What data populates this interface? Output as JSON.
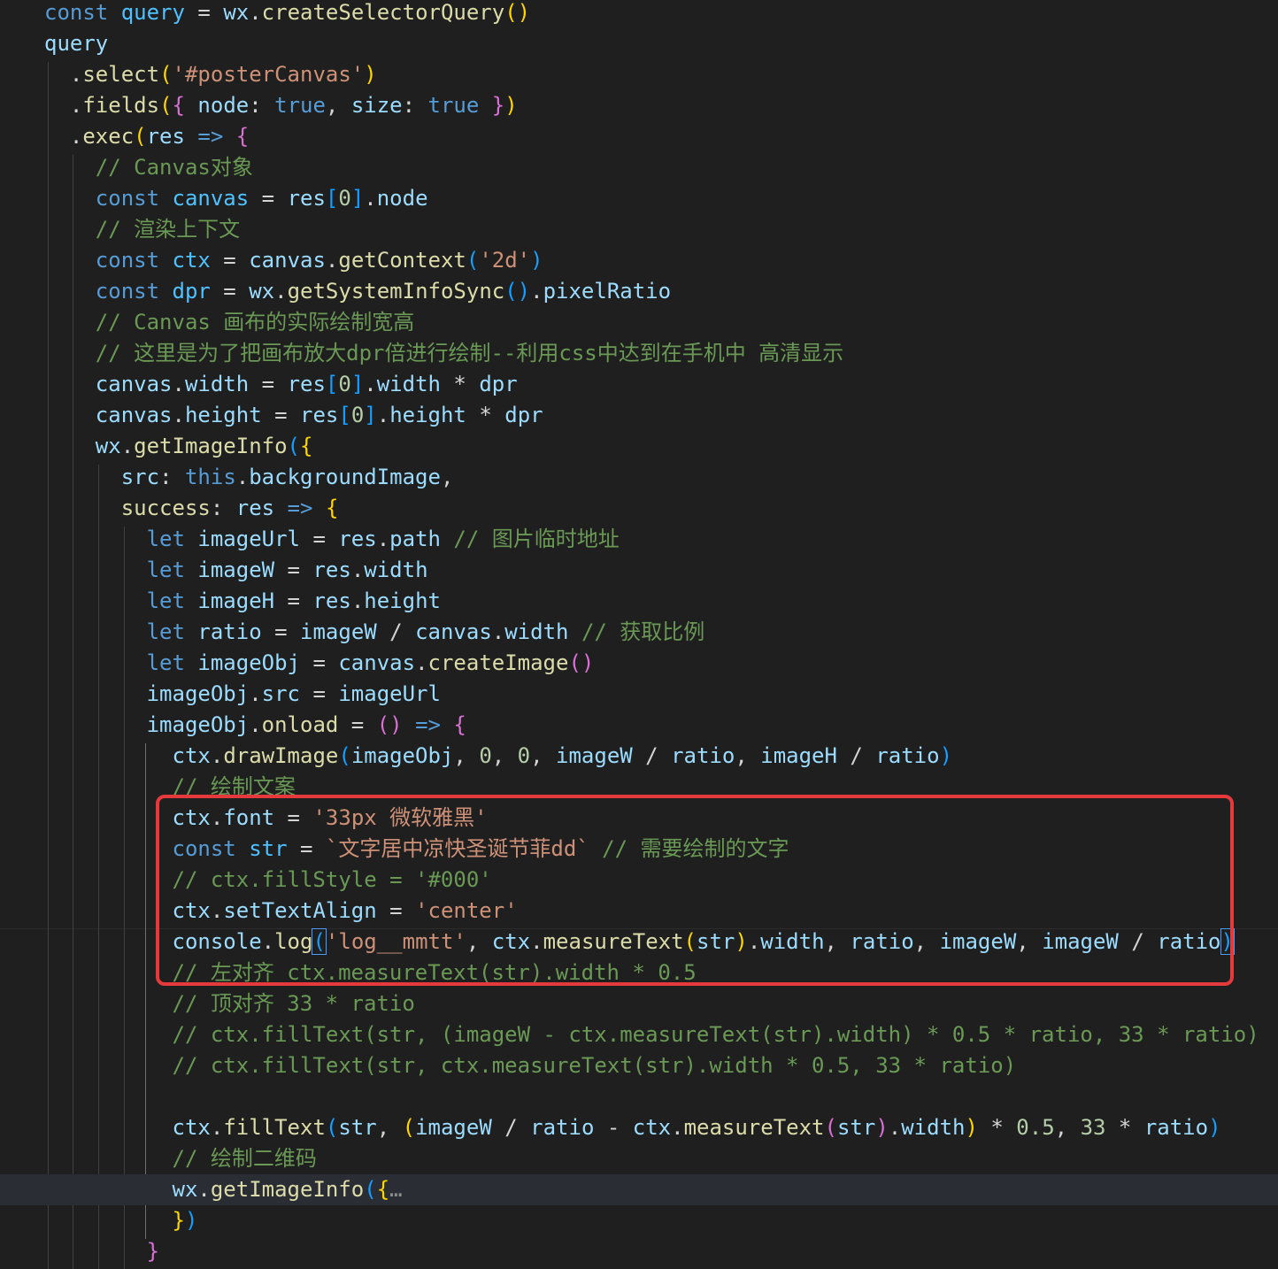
{
  "editor": {
    "lines": [
      [
        [
          "kw",
          "const"
        ],
        [
          "op",
          " "
        ],
        [
          "cst",
          "query"
        ],
        [
          "op",
          " = "
        ],
        [
          "v",
          "wx"
        ],
        [
          "op",
          "."
        ],
        [
          "fn",
          "createSelectorQuery"
        ],
        [
          "b1",
          "()"
        ]
      ],
      [
        [
          "v",
          "query"
        ]
      ],
      [
        [
          "op",
          "  ."
        ],
        [
          "fn",
          "select"
        ],
        [
          "b1",
          "("
        ],
        [
          "s",
          "'#posterCanvas'"
        ],
        [
          "b1",
          ")"
        ]
      ],
      [
        [
          "op",
          "  ."
        ],
        [
          "fn",
          "fields"
        ],
        [
          "b1",
          "("
        ],
        [
          "b2",
          "{"
        ],
        [
          "op",
          " "
        ],
        [
          "v",
          "node"
        ],
        [
          "op",
          ": "
        ],
        [
          "kw",
          "true"
        ],
        [
          "op",
          ", "
        ],
        [
          "v",
          "size"
        ],
        [
          "op",
          ": "
        ],
        [
          "kw",
          "true"
        ],
        [
          "op",
          " "
        ],
        [
          "b2",
          "}"
        ],
        [
          "b1",
          ")"
        ]
      ],
      [
        [
          "op",
          "  ."
        ],
        [
          "fn",
          "exec"
        ],
        [
          "b1",
          "("
        ],
        [
          "v",
          "res"
        ],
        [
          "op",
          " "
        ],
        [
          "kw",
          "=>"
        ],
        [
          "op",
          " "
        ],
        [
          "b2",
          "{"
        ]
      ],
      [
        [
          "c",
          "    // Canvas对象"
        ]
      ],
      [
        [
          "op",
          "    "
        ],
        [
          "kw",
          "const"
        ],
        [
          "op",
          " "
        ],
        [
          "cst",
          "canvas"
        ],
        [
          "op",
          " = "
        ],
        [
          "v",
          "res"
        ],
        [
          "b3",
          "["
        ],
        [
          "n",
          "0"
        ],
        [
          "b3",
          "]"
        ],
        [
          "op",
          "."
        ],
        [
          "v",
          "node"
        ]
      ],
      [
        [
          "c",
          "    // 渲染上下文"
        ]
      ],
      [
        [
          "op",
          "    "
        ],
        [
          "kw",
          "const"
        ],
        [
          "op",
          " "
        ],
        [
          "cst",
          "ctx"
        ],
        [
          "op",
          " = "
        ],
        [
          "v",
          "canvas"
        ],
        [
          "op",
          "."
        ],
        [
          "fn",
          "getContext"
        ],
        [
          "b3",
          "("
        ],
        [
          "s",
          "'2d'"
        ],
        [
          "b3",
          ")"
        ]
      ],
      [
        [
          "op",
          "    "
        ],
        [
          "kw",
          "const"
        ],
        [
          "op",
          " "
        ],
        [
          "cst",
          "dpr"
        ],
        [
          "op",
          " = "
        ],
        [
          "v",
          "wx"
        ],
        [
          "op",
          "."
        ],
        [
          "fn",
          "getSystemInfoSync"
        ],
        [
          "b3",
          "()"
        ],
        [
          "op",
          "."
        ],
        [
          "v",
          "pixelRatio"
        ]
      ],
      [
        [
          "c",
          "    // Canvas 画布的实际绘制宽高"
        ]
      ],
      [
        [
          "c",
          "    // 这里是为了把画布放大dpr倍进行绘制--利用css中达到在手机中 高清显示"
        ]
      ],
      [
        [
          "op",
          "    "
        ],
        [
          "v",
          "canvas"
        ],
        [
          "op",
          "."
        ],
        [
          "v",
          "width"
        ],
        [
          "op",
          " = "
        ],
        [
          "v",
          "res"
        ],
        [
          "b3",
          "["
        ],
        [
          "n",
          "0"
        ],
        [
          "b3",
          "]"
        ],
        [
          "op",
          "."
        ],
        [
          "v",
          "width"
        ],
        [
          "op",
          " * "
        ],
        [
          "v",
          "dpr"
        ]
      ],
      [
        [
          "op",
          "    "
        ],
        [
          "v",
          "canvas"
        ],
        [
          "op",
          "."
        ],
        [
          "v",
          "height"
        ],
        [
          "op",
          " = "
        ],
        [
          "v",
          "res"
        ],
        [
          "b3",
          "["
        ],
        [
          "n",
          "0"
        ],
        [
          "b3",
          "]"
        ],
        [
          "op",
          "."
        ],
        [
          "v",
          "height"
        ],
        [
          "op",
          " * "
        ],
        [
          "v",
          "dpr"
        ]
      ],
      [
        [
          "op",
          "    "
        ],
        [
          "v",
          "wx"
        ],
        [
          "op",
          "."
        ],
        [
          "fn",
          "getImageInfo"
        ],
        [
          "b3",
          "("
        ],
        [
          "b1",
          "{"
        ]
      ],
      [
        [
          "op",
          "      "
        ],
        [
          "v",
          "src"
        ],
        [
          "op",
          ": "
        ],
        [
          "kw",
          "this"
        ],
        [
          "op",
          "."
        ],
        [
          "v",
          "backgroundImage"
        ],
        [
          "op",
          ","
        ]
      ],
      [
        [
          "op",
          "      "
        ],
        [
          "fn",
          "success"
        ],
        [
          "op",
          ": "
        ],
        [
          "v",
          "res"
        ],
        [
          "op",
          " "
        ],
        [
          "kw",
          "=>"
        ],
        [
          "op",
          " "
        ],
        [
          "b1",
          "{"
        ]
      ],
      [
        [
          "op",
          "        "
        ],
        [
          "kw",
          "let"
        ],
        [
          "op",
          " "
        ],
        [
          "v",
          "imageUrl"
        ],
        [
          "op",
          " = "
        ],
        [
          "v",
          "res"
        ],
        [
          "op",
          "."
        ],
        [
          "v",
          "path"
        ],
        [
          "op",
          " "
        ],
        [
          "c",
          "// 图片临时地址"
        ]
      ],
      [
        [
          "op",
          "        "
        ],
        [
          "kw",
          "let"
        ],
        [
          "op",
          " "
        ],
        [
          "v",
          "imageW"
        ],
        [
          "op",
          " = "
        ],
        [
          "v",
          "res"
        ],
        [
          "op",
          "."
        ],
        [
          "v",
          "width"
        ]
      ],
      [
        [
          "op",
          "        "
        ],
        [
          "kw",
          "let"
        ],
        [
          "op",
          " "
        ],
        [
          "v",
          "imageH"
        ],
        [
          "op",
          " = "
        ],
        [
          "v",
          "res"
        ],
        [
          "op",
          "."
        ],
        [
          "v",
          "height"
        ]
      ],
      [
        [
          "op",
          "        "
        ],
        [
          "kw",
          "let"
        ],
        [
          "op",
          " "
        ],
        [
          "v",
          "ratio"
        ],
        [
          "op",
          " = "
        ],
        [
          "v",
          "imageW"
        ],
        [
          "op",
          " / "
        ],
        [
          "v",
          "canvas"
        ],
        [
          "op",
          "."
        ],
        [
          "v",
          "width"
        ],
        [
          "op",
          " "
        ],
        [
          "c",
          "// 获取比例"
        ]
      ],
      [
        [
          "op",
          "        "
        ],
        [
          "kw",
          "let"
        ],
        [
          "op",
          " "
        ],
        [
          "v",
          "imageObj"
        ],
        [
          "op",
          " = "
        ],
        [
          "v",
          "canvas"
        ],
        [
          "op",
          "."
        ],
        [
          "fn",
          "createImage"
        ],
        [
          "b2",
          "()"
        ]
      ],
      [
        [
          "op",
          "        "
        ],
        [
          "v",
          "imageObj"
        ],
        [
          "op",
          "."
        ],
        [
          "v",
          "src"
        ],
        [
          "op",
          " = "
        ],
        [
          "v",
          "imageUrl"
        ]
      ],
      [
        [
          "op",
          "        "
        ],
        [
          "v",
          "imageObj"
        ],
        [
          "op",
          "."
        ],
        [
          "fn",
          "onload"
        ],
        [
          "op",
          " = "
        ],
        [
          "b2",
          "()"
        ],
        [
          "op",
          " "
        ],
        [
          "kw",
          "=>"
        ],
        [
          "op",
          " "
        ],
        [
          "b2",
          "{"
        ]
      ],
      [
        [
          "op",
          "          "
        ],
        [
          "v",
          "ctx"
        ],
        [
          "op",
          "."
        ],
        [
          "fn",
          "drawImage"
        ],
        [
          "b3",
          "("
        ],
        [
          "v",
          "imageObj"
        ],
        [
          "op",
          ", "
        ],
        [
          "n",
          "0"
        ],
        [
          "op",
          ", "
        ],
        [
          "n",
          "0"
        ],
        [
          "op",
          ", "
        ],
        [
          "v",
          "imageW"
        ],
        [
          "op",
          " / "
        ],
        [
          "v",
          "ratio"
        ],
        [
          "op",
          ", "
        ],
        [
          "v",
          "imageH"
        ],
        [
          "op",
          " / "
        ],
        [
          "v",
          "ratio"
        ],
        [
          "b3",
          ")"
        ]
      ],
      [
        [
          "c",
          "          // 绘制文案"
        ]
      ],
      [
        [
          "op",
          "          "
        ],
        [
          "v",
          "ctx"
        ],
        [
          "op",
          "."
        ],
        [
          "v",
          "font"
        ],
        [
          "op",
          " = "
        ],
        [
          "s",
          "'33px 微软雅黑'"
        ]
      ],
      [
        [
          "op",
          "          "
        ],
        [
          "kw",
          "const"
        ],
        [
          "op",
          " "
        ],
        [
          "cst",
          "str"
        ],
        [
          "op",
          " = "
        ],
        [
          "s",
          "`文字居中凉快圣诞节菲dd`"
        ],
        [
          "op",
          " "
        ],
        [
          "c",
          "// 需要绘制的文字"
        ]
      ],
      [
        [
          "c",
          "          // ctx.fillStyle = '#000'"
        ]
      ],
      [
        [
          "op",
          "          "
        ],
        [
          "v",
          "ctx"
        ],
        [
          "op",
          "."
        ],
        [
          "v",
          "setTextAlign"
        ],
        [
          "op",
          " = "
        ],
        [
          "s",
          "'center'"
        ]
      ],
      [
        [
          "op",
          "          "
        ],
        [
          "v",
          "console"
        ],
        [
          "op",
          "."
        ],
        [
          "fn",
          "log"
        ],
        [
          "b3 bm",
          "("
        ],
        [
          "s",
          "'log__mmtt'"
        ],
        [
          "op",
          ", "
        ],
        [
          "v",
          "ctx"
        ],
        [
          "op",
          "."
        ],
        [
          "fn",
          "measureText"
        ],
        [
          "b1",
          "("
        ],
        [
          "v",
          "str"
        ],
        [
          "b1",
          ")"
        ],
        [
          "op",
          "."
        ],
        [
          "v",
          "width"
        ],
        [
          "op",
          ", "
        ],
        [
          "v",
          "ratio"
        ],
        [
          "op",
          ", "
        ],
        [
          "v",
          "imageW"
        ],
        [
          "op",
          ", "
        ],
        [
          "v",
          "imageW"
        ],
        [
          "op",
          " / "
        ],
        [
          "v",
          "ratio"
        ],
        [
          "b3 bm",
          ")"
        ]
      ],
      [
        [
          "c",
          "          // 左对齐 ctx.measureText(str).width * 0.5"
        ]
      ],
      [
        [
          "c",
          "          // 顶对齐 33 * ratio"
        ]
      ],
      [
        [
          "c",
          "          // ctx.fillText(str, (imageW - ctx.measureText(str).width) * 0.5 * ratio, 33 * ratio)"
        ]
      ],
      [
        [
          "c",
          "          // ctx.fillText(str, ctx.measureText(str).width * 0.5, 33 * ratio)"
        ]
      ],
      [],
      [
        [
          "op",
          "          "
        ],
        [
          "v",
          "ctx"
        ],
        [
          "op",
          "."
        ],
        [
          "fn",
          "fillText"
        ],
        [
          "b3",
          "("
        ],
        [
          "v",
          "str"
        ],
        [
          "op",
          ", "
        ],
        [
          "b1",
          "("
        ],
        [
          "v",
          "imageW"
        ],
        [
          "op",
          " / "
        ],
        [
          "v",
          "ratio"
        ],
        [
          "op",
          " - "
        ],
        [
          "v",
          "ctx"
        ],
        [
          "op",
          "."
        ],
        [
          "fn",
          "measureText"
        ],
        [
          "b2",
          "("
        ],
        [
          "v",
          "str"
        ],
        [
          "b2",
          ")"
        ],
        [
          "op",
          "."
        ],
        [
          "v",
          "width"
        ],
        [
          "b1",
          ")"
        ],
        [
          "op",
          " * "
        ],
        [
          "n",
          "0.5"
        ],
        [
          "op",
          ", "
        ],
        [
          "n",
          "33"
        ],
        [
          "op",
          " * "
        ],
        [
          "v",
          "ratio"
        ],
        [
          "b3",
          ")"
        ]
      ],
      [
        [
          "c",
          "          // 绘制二维码"
        ]
      ],
      [
        [
          "op",
          "          "
        ],
        [
          "v",
          "wx"
        ],
        [
          "op",
          "."
        ],
        [
          "fn",
          "getImageInfo"
        ],
        [
          "b3",
          "("
        ],
        [
          "b1",
          "{"
        ],
        [
          "fold",
          "…"
        ]
      ],
      [
        [
          "op",
          "          "
        ],
        [
          "b1",
          "}"
        ],
        [
          "b3",
          ")"
        ]
      ],
      [
        [
          "op",
          "        "
        ],
        [
          "b2",
          "}"
        ]
      ]
    ]
  },
  "highlight_color": "#e5393c",
  "fold_icon": "ellipsis-icon"
}
